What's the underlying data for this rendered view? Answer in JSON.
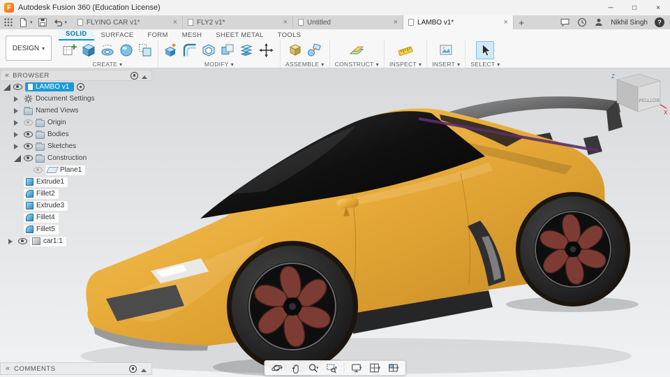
{
  "glyphs": {
    "caret": "▾",
    "collapse": "«",
    "close": "×",
    "plus": "+",
    "minimize": "─",
    "maximize": "□",
    "help": "?"
  },
  "titlebar": {
    "title": "Autodesk Fusion 360 (Education License)"
  },
  "tabbar": {
    "tabs": [
      {
        "label": "FLYING CAR v1*"
      },
      {
        "label": "FLY2 v1*"
      },
      {
        "label": "Untitled"
      },
      {
        "label": "LAMBO v1*"
      }
    ],
    "user_name": "Nikhil Singh"
  },
  "ribbon": {
    "design_label": "DESIGN",
    "tabs": [
      {
        "label": "SOLID"
      },
      {
        "label": "SURFACE"
      },
      {
        "label": "FORM"
      },
      {
        "label": "MESH"
      },
      {
        "label": "SHEET METAL"
      },
      {
        "label": "TOOLS"
      }
    ],
    "groups": [
      {
        "label": "CREATE"
      },
      {
        "label": "MODIFY"
      },
      {
        "label": "ASSEMBLE"
      },
      {
        "label": "CONSTRUCT"
      },
      {
        "label": "INSPECT"
      },
      {
        "label": "INSERT"
      },
      {
        "label": "SELECT"
      }
    ]
  },
  "browser": {
    "title": "BROWSER",
    "items": [
      {
        "label": "LAMBO v1"
      },
      {
        "label": "Document Settings"
      },
      {
        "label": "Named Views"
      },
      {
        "label": "Origin"
      },
      {
        "label": "Bodies"
      },
      {
        "label": "Sketches"
      },
      {
        "label": "Construction"
      },
      {
        "label": "Plane1"
      },
      {
        "label": "Extrude1"
      },
      {
        "label": "Fillet2"
      },
      {
        "label": "Extrude3"
      },
      {
        "label": "Fillet4"
      },
      {
        "label": "Fillet5"
      },
      {
        "label": "car1:1"
      }
    ]
  },
  "viewport": {
    "viewcube_face_label": "BOTTOM",
    "axis_x": "X",
    "axis_z": "Z"
  },
  "comments": {
    "title": "COMMENTS"
  },
  "colors": {
    "accent": "#0696d7",
    "selection": "#1a9bd8",
    "car_body": "#e3a83c",
    "car_glass": "#141414",
    "wheel_spoke": "#7d3c33",
    "trim_purple": "#5b2d6e"
  }
}
